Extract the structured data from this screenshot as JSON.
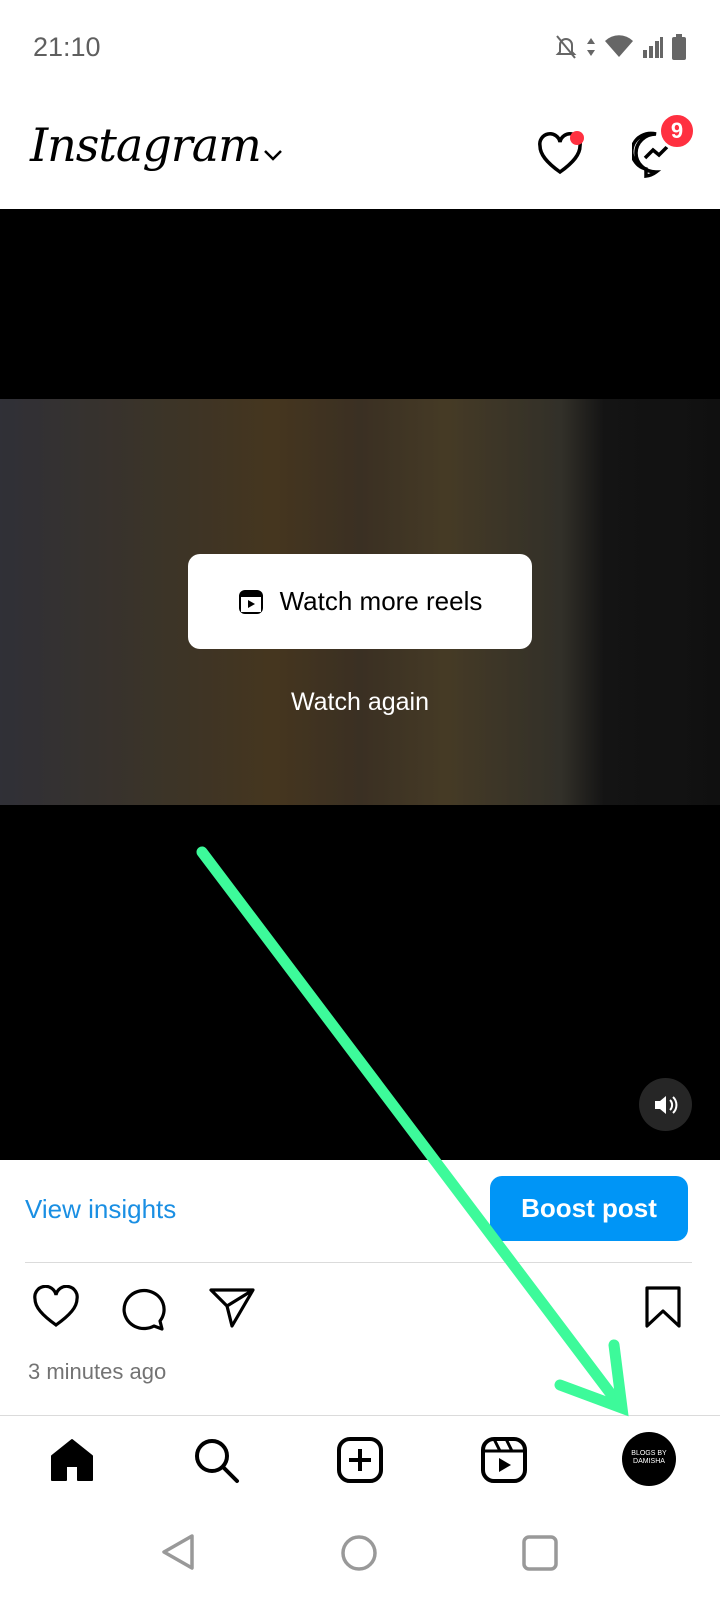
{
  "status_bar": {
    "time": "21:10",
    "icons": [
      "bell-off-icon",
      "data-arrows-icon",
      "wifi-icon",
      "signal-icon",
      "battery-icon"
    ]
  },
  "header": {
    "logo": "Instagram",
    "messenger_badge": "9",
    "notification_dot": true,
    "badge_color": "#ff3040"
  },
  "reel": {
    "watch_more_label": "Watch more reels",
    "watch_again_label": "Watch again"
  },
  "post": {
    "insights_label": "View insights",
    "boost_label": "Boost post",
    "timestamp": "3 minutes ago",
    "accent": "#0095f6"
  },
  "bottom_nav": {
    "items": [
      "home",
      "search",
      "create",
      "reels",
      "profile"
    ],
    "avatar_text": "BLOGS BY DAMISHA"
  },
  "annotation": {
    "arrow_color": "#3dfa9a"
  }
}
